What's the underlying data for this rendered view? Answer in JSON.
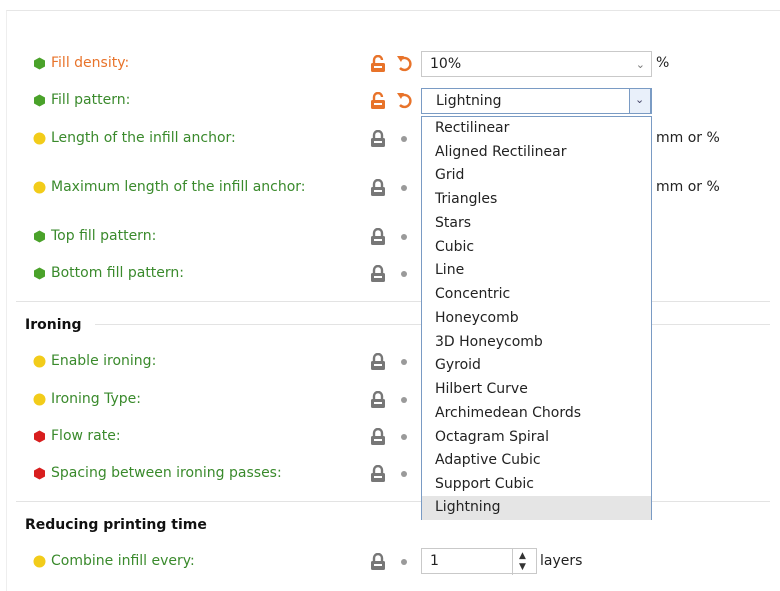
{
  "colors": {
    "orange": "#e8732a",
    "green_label": "#3a8a2c",
    "dot_green": "#4aa22a",
    "dot_yellow": "#f2cc1a",
    "dot_red": "#d81e1e",
    "lock_grey": "#777777"
  },
  "fill": {
    "density_label": "Fill density:",
    "density_value": "10%",
    "density_unit": "%",
    "pattern_label": "Fill pattern:",
    "pattern_value": "Lightning",
    "anchor_label": "Length of the infill anchor:",
    "anchor_unit": "mm or %",
    "max_anchor_label": "Maximum length of the infill anchor:",
    "max_anchor_unit": "mm or %",
    "top_pattern_label": "Top fill pattern:",
    "bottom_pattern_label": "Bottom fill pattern:"
  },
  "ironing": {
    "title": "Ironing",
    "enable_label": "Enable ironing:",
    "type_label": "Ironing Type:",
    "flow_label": "Flow rate:",
    "spacing_label": "Spacing between ironing passes:"
  },
  "reducing": {
    "title": "Reducing printing time",
    "combine_label": "Combine infill every:",
    "combine_value": "1",
    "combine_unit": "layers"
  },
  "dropdown": {
    "options": [
      "Rectilinear",
      "Aligned Rectilinear",
      "Grid",
      "Triangles",
      "Stars",
      "Cubic",
      "Line",
      "Concentric",
      "Honeycomb",
      "3D Honeycomb",
      "Gyroid",
      "Hilbert Curve",
      "Archimedean Chords",
      "Octagram Spiral",
      "Adaptive Cubic",
      "Support Cubic",
      "Lightning"
    ],
    "selected": "Lightning"
  },
  "icons": {
    "lock_open": "unlocked-lock-icon",
    "lock_closed": "locked-lock-icon",
    "undo": "undo-arrow-icon",
    "bullet": "system-value-dot-icon",
    "chevron": "chevron-down-icon"
  }
}
